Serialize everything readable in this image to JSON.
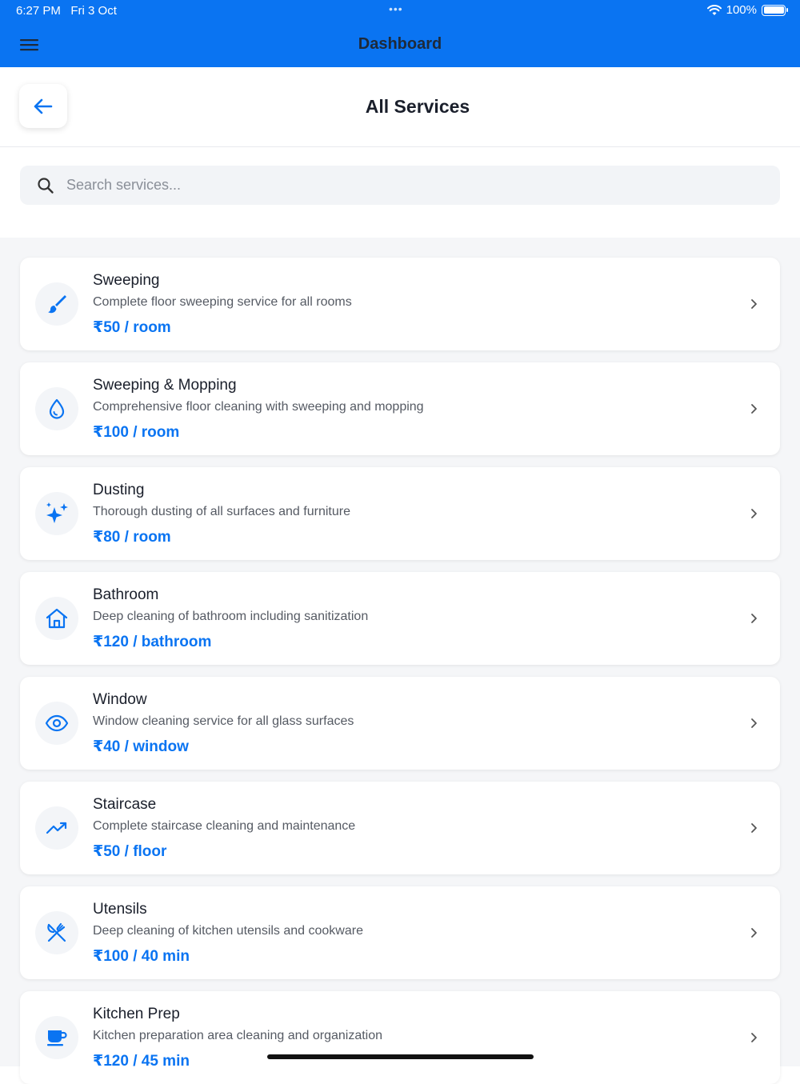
{
  "status": {
    "time": "6:27 PM",
    "date": "Fri 3 Oct",
    "battery": "100%",
    "dots": "•••"
  },
  "nav": {
    "title": "Dashboard"
  },
  "header": {
    "title": "All Services"
  },
  "search": {
    "placeholder": "Search services..."
  },
  "colors": {
    "accent": "#0a74f2",
    "background": "#f5f6f8"
  },
  "services": [
    {
      "name": "Sweeping",
      "desc": "Complete floor sweeping service for all rooms",
      "price": "₹50 / room",
      "icon": "brush-icon"
    },
    {
      "name": "Sweeping & Mopping",
      "desc": "Comprehensive floor cleaning with sweeping and mopping",
      "price": "₹100 / room",
      "icon": "droplet-icon"
    },
    {
      "name": "Dusting",
      "desc": "Thorough dusting of all surfaces and furniture",
      "price": "₹80 / room",
      "icon": "sparkles-icon"
    },
    {
      "name": "Bathroom",
      "desc": "Deep cleaning of bathroom including sanitization",
      "price": "₹120 / bathroom",
      "icon": "home-icon"
    },
    {
      "name": "Window",
      "desc": "Window cleaning service for all glass surfaces",
      "price": "₹40 / window",
      "icon": "eye-icon"
    },
    {
      "name": "Staircase",
      "desc": "Complete staircase cleaning and maintenance",
      "price": "₹50 / floor",
      "icon": "trending-up-icon"
    },
    {
      "name": "Utensils",
      "desc": "Deep cleaning of kitchen utensils and cookware",
      "price": "₹100 / 40 min",
      "icon": "utensils-icon"
    },
    {
      "name": "Kitchen Prep",
      "desc": "Kitchen preparation area cleaning and organization",
      "price": "₹120 / 45 min",
      "icon": "cup-icon"
    }
  ]
}
